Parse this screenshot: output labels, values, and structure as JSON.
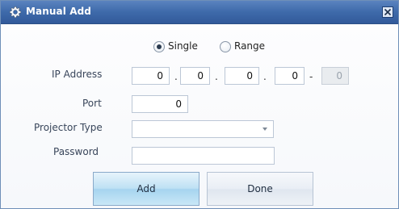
{
  "window": {
    "title": "Manual Add",
    "close_symbol": "X"
  },
  "mode": {
    "single_label": "Single",
    "range_label": "Range",
    "selected": "Single"
  },
  "ip": {
    "label": "IP Address",
    "octets": [
      "0",
      "0",
      "0",
      "0"
    ],
    "range_end": "0",
    "separator": "."
  },
  "port": {
    "label": "Port",
    "value": "0"
  },
  "projector_type": {
    "label": "Projector Type",
    "value": ""
  },
  "password": {
    "label": "Password",
    "value": ""
  },
  "buttons": {
    "add": "Add",
    "done": "Done"
  },
  "icons": {
    "title_icon": "gear-icon",
    "close_icon": "close-icon",
    "dropdown_icon": "chevron-down-icon"
  }
}
